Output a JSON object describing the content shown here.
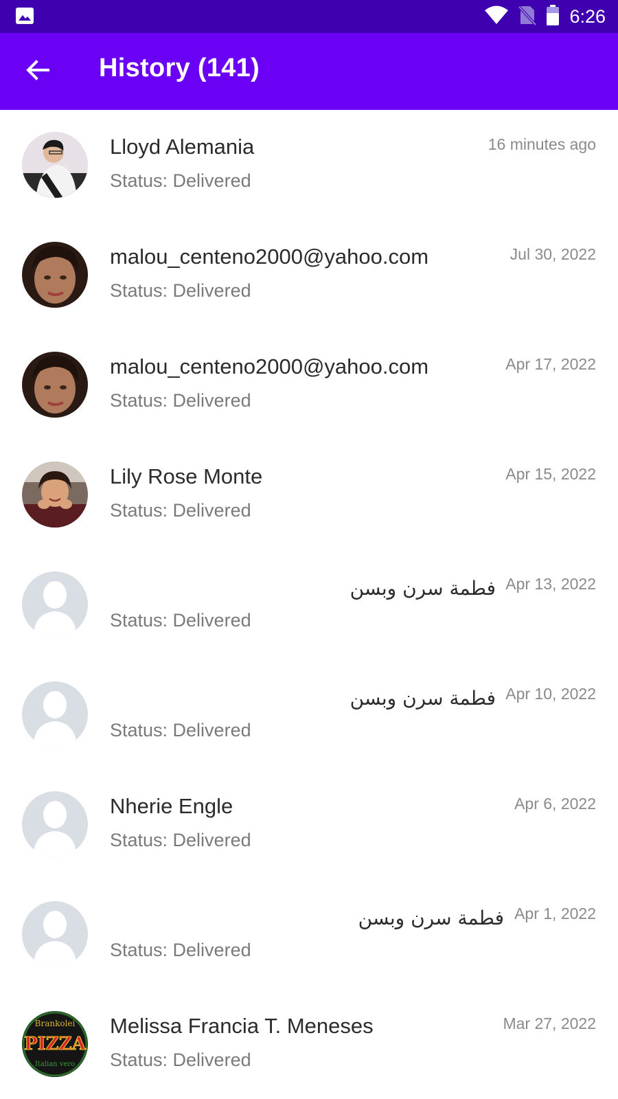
{
  "status_bar": {
    "time": "6:26"
  },
  "app_bar": {
    "title": "History (141)"
  },
  "colors": {
    "status_bar": "#3f00b0",
    "app_bar": "#6a00f4",
    "accent": "#6a00f4"
  },
  "rows": [
    {
      "name": "Lloyd Alemania",
      "status": "Status: Delivered",
      "time": "16 minutes ago",
      "avatar": "photo-man"
    },
    {
      "name": "malou_centeno2000@yahoo.com",
      "status": "Status: Delivered",
      "time": "Jul 30, 2022",
      "avatar": "photo-woman"
    },
    {
      "name": "malou_centeno2000@yahoo.com",
      "status": "Status: Delivered",
      "time": "Apr 17, 2022",
      "avatar": "photo-woman"
    },
    {
      "name": "Lily Rose Monte",
      "status": "Status: Delivered",
      "time": "Apr 15, 2022",
      "avatar": "photo-girl"
    },
    {
      "name": "فطمة سرن وبسن",
      "status": "Status: Delivered",
      "time": "Apr 13, 2022",
      "avatar": "placeholder"
    },
    {
      "name": "فطمة سرن وبسن",
      "status": "Status: Delivered",
      "time": "Apr 10, 2022",
      "avatar": "placeholder"
    },
    {
      "name": "Nherie Engle",
      "status": "Status: Delivered",
      "time": "Apr 6, 2022",
      "avatar": "placeholder"
    },
    {
      "name": "فطمة سرن وبسن",
      "status": "Status: Delivered",
      "time": "Apr 1, 2022",
      "avatar": "placeholder"
    },
    {
      "name": "Melissa Francia T. Meneses",
      "status": "Status: Delivered",
      "time": "Mar 27, 2022",
      "avatar": "pizza-logo",
      "logo_text": [
        "Brankolei",
        "PIZZA",
        "Italian vero"
      ]
    }
  ]
}
